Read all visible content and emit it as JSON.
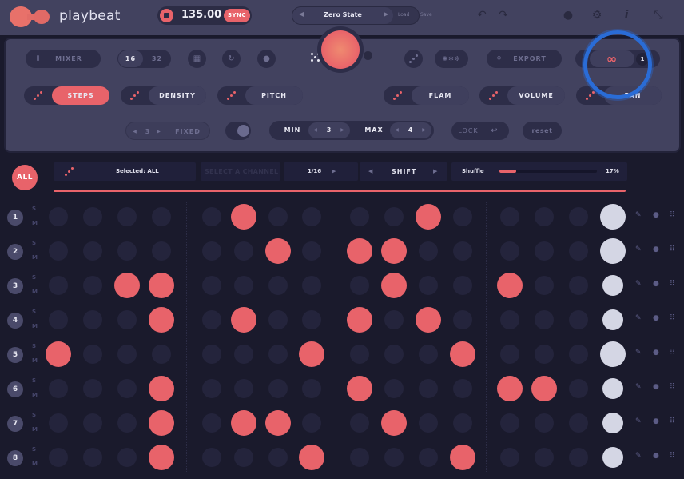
{
  "header": {
    "brand": "playbeat",
    "tempo": "135.00",
    "sync_label": "SYNC",
    "preset": {
      "name": "Zero State",
      "load_label": "Load",
      "save_label": "Save"
    },
    "icons": [
      "undo-icon",
      "redo-icon",
      "dial-icon",
      "gear-icon",
      "info-icon",
      "expand-icon"
    ]
  },
  "panel": {
    "mixer_label": "MIXER",
    "steps_options": [
      "16",
      "32"
    ],
    "steps_selected": "16",
    "export_label": "EXPORT",
    "loop_count": "1",
    "params": [
      {
        "label": "STEPS",
        "active": true
      },
      {
        "label": "DENSITY",
        "active": false
      },
      {
        "label": "PITCH",
        "active": false
      },
      {
        "label": "FLAM",
        "active": false
      },
      {
        "label": "VOLUME",
        "active": false
      },
      {
        "label": "PAN",
        "active": false
      }
    ],
    "fixed": {
      "value": "3",
      "label": "FIXED"
    },
    "min": {
      "label": "MIN",
      "value": "3"
    },
    "max": {
      "label": "MAX",
      "value": "4"
    },
    "lock_label": "LOCK",
    "reset_label": "reset"
  },
  "toolbar": {
    "all_label": "ALL",
    "selected_label": "Selected: ALL",
    "channel_placeholder": "SELECT A CHANNEL",
    "division": "1/16",
    "shift_label": "SHIFT",
    "shuffle_label": "Shuffle",
    "shuffle_value": "17%",
    "shuffle_fraction": 0.17
  },
  "grid": {
    "solo_label": "S",
    "mute_label": "M",
    "steps_count": 15,
    "channels": [
      {
        "number": "1",
        "active_steps": [
          6,
          11
        ],
        "volume": "large"
      },
      {
        "number": "2",
        "active_steps": [
          7,
          9,
          10
        ],
        "volume": "large"
      },
      {
        "number": "3",
        "active_steps": [
          3,
          4,
          10,
          13
        ],
        "volume": "small"
      },
      {
        "number": "4",
        "active_steps": [
          4,
          6,
          9,
          11
        ],
        "volume": "small"
      },
      {
        "number": "5",
        "active_steps": [
          1,
          8,
          12
        ],
        "volume": "large"
      },
      {
        "number": "6",
        "active_steps": [
          4,
          9,
          13,
          14
        ],
        "volume": "small"
      },
      {
        "number": "7",
        "active_steps": [
          4,
          6,
          7,
          10
        ],
        "volume": "small"
      },
      {
        "number": "8",
        "active_steps": [
          4,
          8,
          12
        ],
        "volume": "small"
      }
    ]
  },
  "colors": {
    "accent": "#e8636a",
    "panel": "#42425f",
    "background": "#1a1a2c",
    "highlight": "#2a6cd6"
  }
}
